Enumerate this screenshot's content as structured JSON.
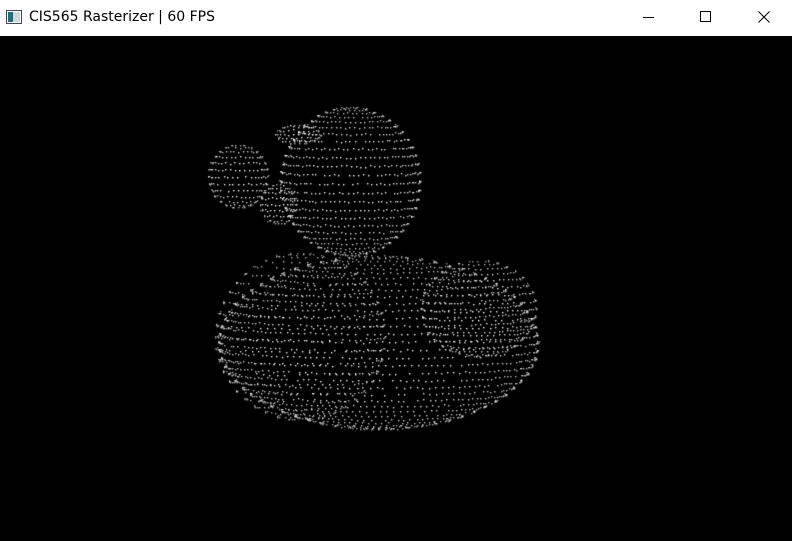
{
  "window": {
    "title": "CIS565 Rasterizer | 60 FPS",
    "icon": "app-window-icon",
    "controls": {
      "minimize_icon": "minimize-icon",
      "maximize_icon": "maximize-icon",
      "close_icon": "close-icon"
    }
  },
  "viewport": {
    "background": "#000000",
    "point_color": "#ffffff",
    "content": "point-cloud-duck"
  }
}
